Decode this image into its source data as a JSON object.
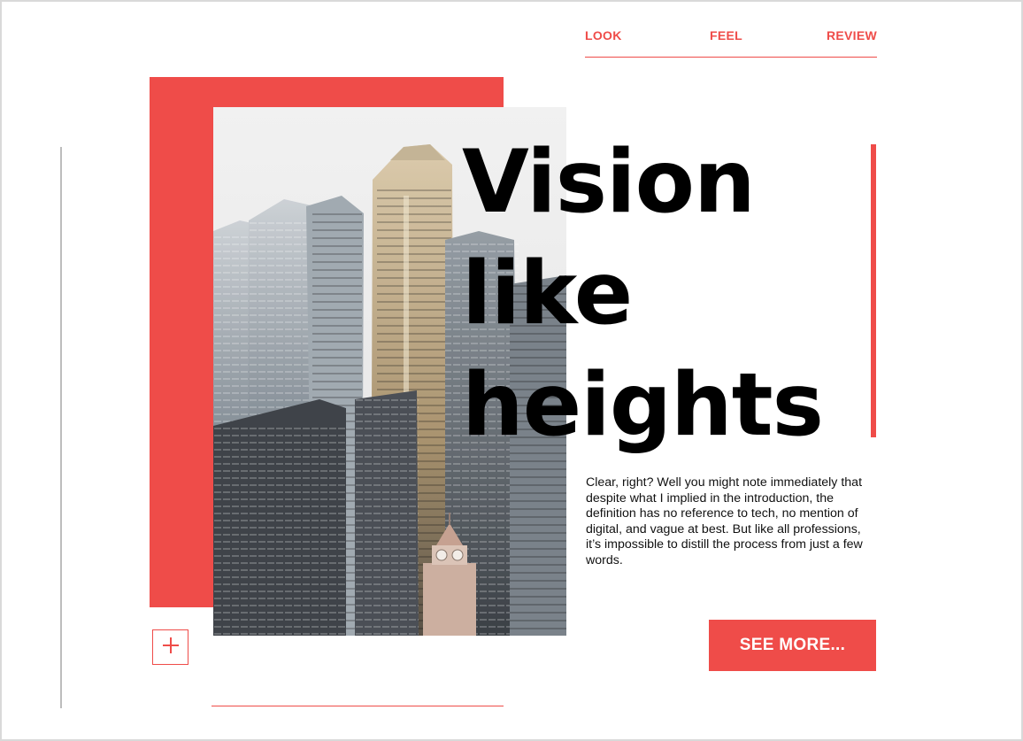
{
  "nav": {
    "items": [
      {
        "label": "LOOK"
      },
      {
        "label": "FEEL"
      },
      {
        "label": "REVIEW"
      }
    ]
  },
  "hero": {
    "headline_lines": [
      "Vision",
      "like",
      "heights"
    ],
    "body": "Clear, right? Well you might note immediately that despite what I implied in the introduction, the definition has no reference to tech, no mention of digital, and vague at best. But like all professions, it’s impossible to distill the process from just a few words.",
    "cta_label": "SEE MORE..."
  },
  "icons": {
    "plus": "plus-icon"
  },
  "colors": {
    "accent": "#ef4c49",
    "text": "#000000",
    "rule": "#bdbdbd"
  }
}
